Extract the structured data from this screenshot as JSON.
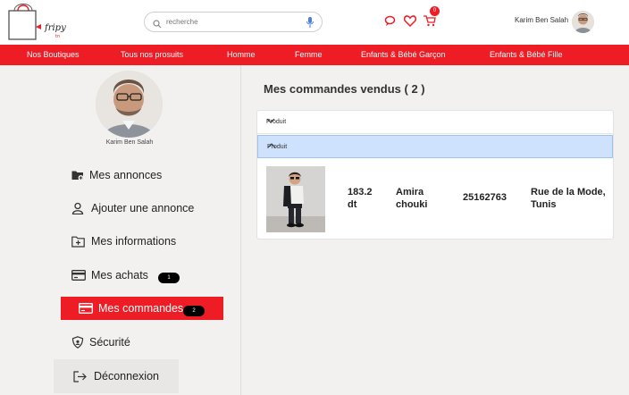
{
  "header": {
    "brand": "fripy",
    "brand_sub": "tn",
    "search_placeholder": "recherche",
    "cart_count": "0",
    "user_name": "Karim Ben Salah"
  },
  "nav": {
    "items": [
      "Nos Boutiques",
      "Tous nos prosuits",
      "Homme",
      "Femme",
      "Enfants & Bébé Garçon",
      "Enfants & Bébé Fille"
    ]
  },
  "sidebar": {
    "user_name": "Karim Ben Salah",
    "items": [
      {
        "label": "Mes annonces",
        "icon": "folder-add-icon"
      },
      {
        "label": "Ajouter une annonce",
        "icon": "user-icon"
      },
      {
        "label": "Mes informations",
        "icon": "folder-plus-icon"
      },
      {
        "label": "Mes achats",
        "icon": "card-icon",
        "badge": "1"
      },
      {
        "label": "Mes commandes",
        "icon": "card-icon",
        "badge": "2"
      },
      {
        "label": "Sécurité",
        "icon": "shield-icon"
      },
      {
        "label": "Déconnexion",
        "icon": "logout-icon"
      }
    ]
  },
  "main": {
    "title": "Mes commandes vendus ( 2 )",
    "accordion": [
      {
        "label": "Produit"
      },
      {
        "label": "Produit"
      }
    ],
    "order": {
      "price": "183.2 dt",
      "buyer": "Amira chouki",
      "phone": "25162763",
      "address": "Rue de la Mode, Tunis"
    }
  },
  "colors": {
    "accent": "#ee1c25",
    "active_accordion": "#cfe2fd"
  }
}
